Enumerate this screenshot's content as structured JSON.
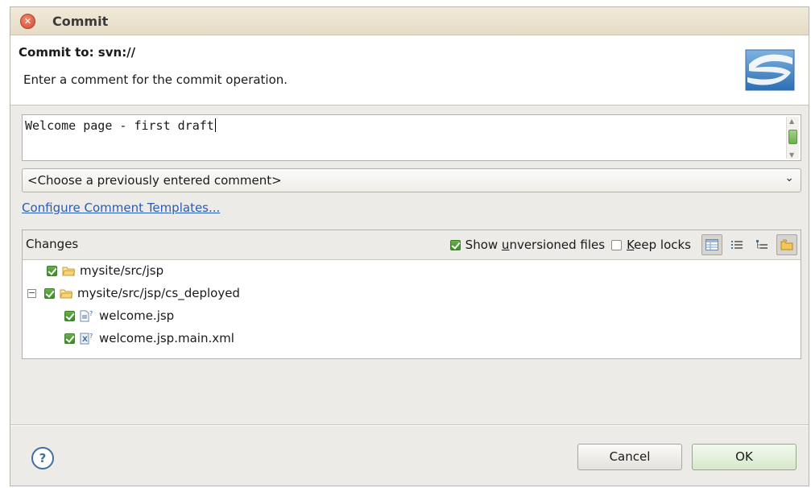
{
  "window": {
    "title": "Commit"
  },
  "header": {
    "title": "Commit to: svn://",
    "description": "Enter a comment for the commit operation."
  },
  "comment": {
    "value": "Welcome page - first draft"
  },
  "history": {
    "selected": "<Choose a previously entered comment>"
  },
  "templates_link": "Configure Comment Templates...",
  "changes": {
    "label": "Changes",
    "show_unversioned": {
      "label": "Show unversioned files",
      "checked": true
    },
    "keep_locks": {
      "label": "Keep locks",
      "checked": false
    },
    "toolbar_icons": [
      "table-view-icon",
      "flat-list-icon",
      "tree-view-icon",
      "compressed-folders-icon"
    ],
    "items": [
      {
        "label": "mysite/src/jsp",
        "type": "folder",
        "checked": true
      },
      {
        "label": "mysite/src/jsp/cs_deployed",
        "type": "folder",
        "checked": true,
        "expanded": true
      },
      {
        "label": "welcome.jsp",
        "type": "jsp-file",
        "checked": true
      },
      {
        "label": "welcome.jsp.main.xml",
        "type": "xml-file",
        "checked": true
      }
    ]
  },
  "buttons": {
    "cancel": "Cancel",
    "ok": "OK"
  },
  "colors": {
    "link": "#2a5db0",
    "check_green": "#4f9a35",
    "title_bg": "#ece3cf"
  }
}
